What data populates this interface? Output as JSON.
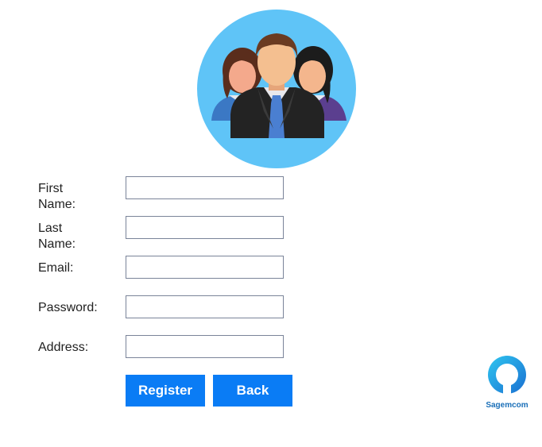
{
  "avatar": {
    "icon": "users-group-icon",
    "circle_color": "#5fc4f7"
  },
  "form": {
    "fields": [
      {
        "label": "First Name:",
        "value": "",
        "type": "text"
      },
      {
        "label": "Last Name:",
        "value": "",
        "type": "text"
      },
      {
        "label": "Email:",
        "value": "",
        "type": "text"
      },
      {
        "label": "Password:",
        "value": "",
        "type": "password"
      },
      {
        "label": "Address:",
        "value": "",
        "type": "text"
      }
    ]
  },
  "buttons": {
    "register_label": "Register",
    "back_label": "Back",
    "color": "#0a7cf5"
  },
  "brand": {
    "name": "Sagemcom",
    "color": "#1a9be0"
  }
}
